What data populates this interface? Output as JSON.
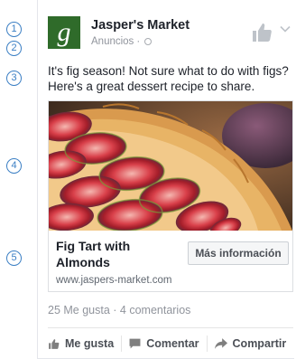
{
  "markers": [
    "1",
    "2",
    "3",
    "4",
    "5"
  ],
  "ad": {
    "page_name": "Jasper's Market",
    "logo_letter": "g",
    "sponsored_label": "Anuncios",
    "separator": "·",
    "icons": {
      "globe": "globe-icon",
      "like": "thumbs-up-icon",
      "menu": "chevron-down-icon"
    }
  },
  "post": {
    "text": "It's fig season! Not sure what to do with figs? Here's a great dessert recipe to share."
  },
  "link": {
    "title": "Fig Tart with Almonds",
    "domain": "www.jaspers-market.com",
    "cta_label": "Más información"
  },
  "engagement": {
    "summary": "25 Me gusta · 4 comentarios"
  },
  "actions": {
    "like_label": "Me gusta",
    "comment_label": "Comentar",
    "share_label": "Compartir"
  },
  "colors": {
    "brand_green": "#2f6b2a",
    "marker_blue": "#3b7fc4",
    "muted_text": "#90949c"
  }
}
